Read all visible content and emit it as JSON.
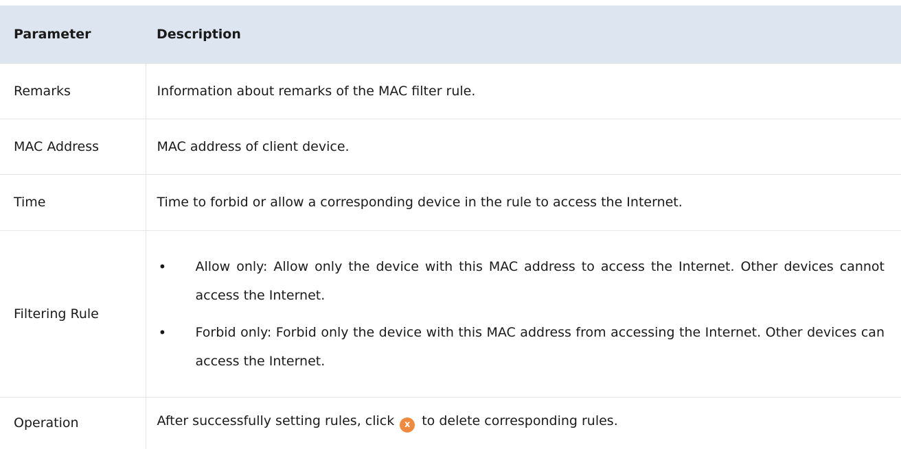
{
  "table": {
    "headers": [
      "Parameter",
      "Description"
    ],
    "rows": {
      "remarks": {
        "param": "Remarks",
        "desc": "Information about remarks of the MAC filter rule."
      },
      "mac": {
        "param": "MAC Address",
        "desc": "MAC address of client device."
      },
      "time": {
        "param": "Time",
        "desc": "Time to forbid or allow a corresponding device in the rule to access the Internet."
      },
      "filter": {
        "param": "Filtering Rule",
        "bullets": [
          "Allow only: Allow only the device with this MAC address to access the Internet. Other devices cannot access the Internet.",
          "Forbid only: Forbid only the device with this MAC address from accessing the Internet. Other devices can access the Internet."
        ]
      },
      "operation": {
        "param": "Operation",
        "desc_before": "After successfully setting rules, click",
        "icon": "delete-icon",
        "icon_glyph": "x",
        "desc_after": "to delete corresponding rules."
      }
    }
  },
  "colors": {
    "header_bg": "#dde6f0",
    "delete_icon": "#f08a3c"
  },
  "bullet_char": "•"
}
